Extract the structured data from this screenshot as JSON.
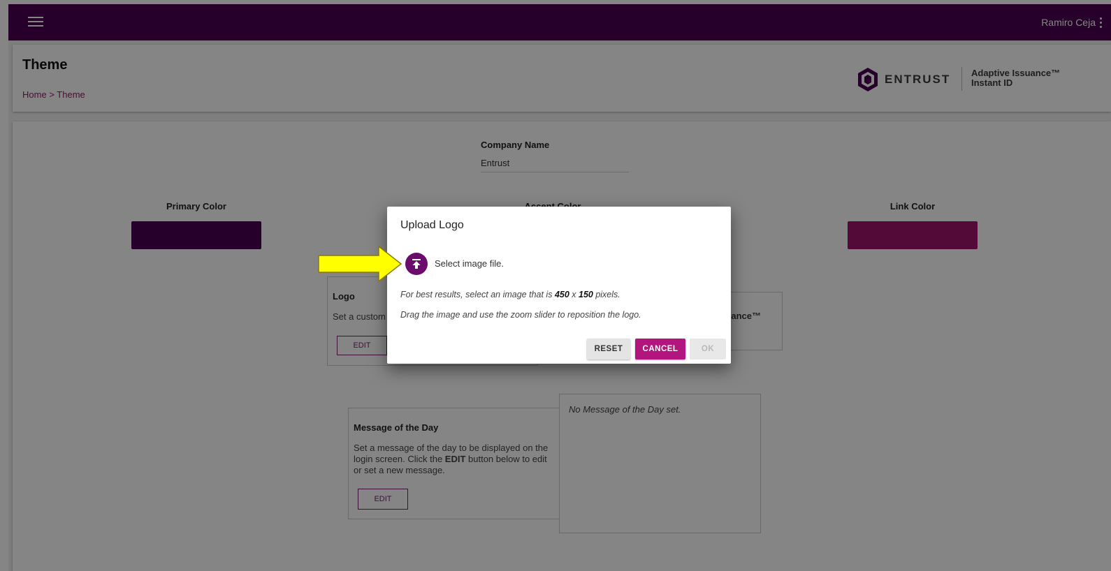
{
  "user": {
    "name": "Ramiro Ceja"
  },
  "header": {
    "title": "Theme",
    "breadcrumb": [
      "Home",
      ">",
      "Theme"
    ],
    "brand_name": "ENTRUST",
    "product_line1": "Adaptive Issuance™",
    "product_line2": "Instant ID"
  },
  "company": {
    "label": "Company Name",
    "value": "Entrust"
  },
  "colors": {
    "primary_label": "Primary Color",
    "primary_value": "#4a0052",
    "accent_label": "Accent Color",
    "link_label": "Link Color",
    "link_value": "#a0146e"
  },
  "logo_section": {
    "title": "Logo",
    "description": "Set a custom",
    "edit_label": "EDIT",
    "preview_partial": "uance™"
  },
  "motd_section": {
    "title": "Message of the Day",
    "description_part1": "Set a message of the day to be displayed on the login screen. Click the ",
    "description_bold": "EDIT",
    "description_part2": " button below to edit or set a new message.",
    "edit_label": "EDIT",
    "preview": "No Message of the Day set."
  },
  "dialog": {
    "title": "Upload Logo",
    "select_label": "Select image file.",
    "hint1_prefix": "For best results, select an image that is ",
    "hint1_width": "450",
    "hint1_x": " x ",
    "hint1_height": "150",
    "hint1_suffix": " pixels.",
    "hint2": "Drag the image and use the zoom slider to reposition the logo.",
    "reset_label": "RESET",
    "cancel_label": "CANCEL",
    "ok_label": "OK"
  },
  "icons": {
    "menu": "hamburger-icon",
    "more": "kebab-icon",
    "upload": "upload-icon",
    "annotation": "yellow-arrow"
  },
  "accent_colors": {
    "app_bar": "#4a0052",
    "cancel_button": "#b3157f",
    "annotation_arrow": "#ffff00"
  }
}
